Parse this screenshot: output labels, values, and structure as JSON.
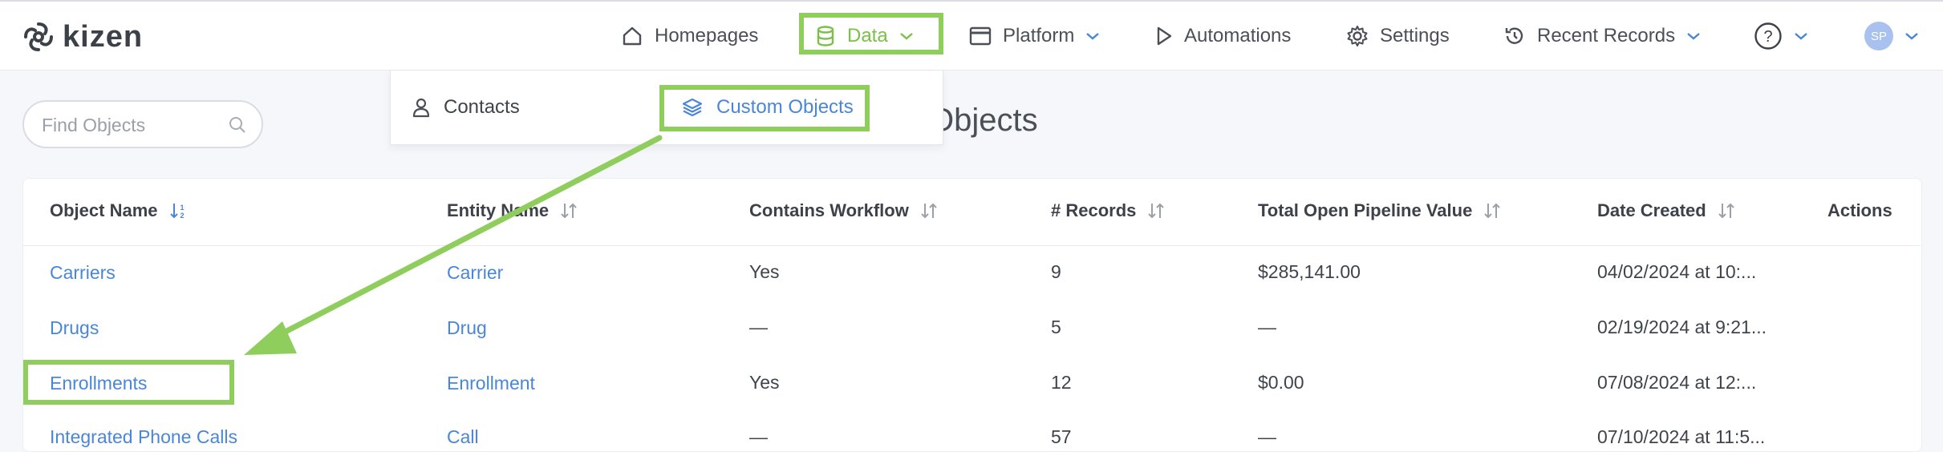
{
  "brand": {
    "name": "kizen"
  },
  "nav": {
    "homepages": "Homepages",
    "data": "Data",
    "platform": "Platform",
    "automations": "Automations",
    "settings": "Settings",
    "recent_records": "Recent Records",
    "help_icon": "question-circle-icon",
    "avatar_initials": "SP"
  },
  "dropdown": {
    "contacts": "Contacts",
    "custom_objects": "Custom Objects"
  },
  "search": {
    "placeholder": "Find Objects"
  },
  "page": {
    "title_visible_fragment": "Objects"
  },
  "table": {
    "columns": [
      "Object Name",
      "Entity Name",
      "Contains Workflow",
      "# Records",
      "Total Open Pipeline Value",
      "Date Created",
      "Actions"
    ],
    "rows": [
      [
        "Carriers",
        "Carrier",
        "Yes",
        "9",
        "$285,141.00",
        "04/02/2024 at 10:..."
      ],
      [
        "Drugs",
        "Drug",
        "—",
        "5",
        "—",
        "02/19/2024 at 9:21..."
      ],
      [
        "Enrollments",
        "Enrollment",
        "Yes",
        "12",
        "$0.00",
        "07/08/2024 at 12:..."
      ],
      [
        "Integrated Phone Calls",
        "Call",
        "—",
        "57",
        "—",
        "07/10/2024 at 11:5..."
      ]
    ]
  },
  "colors": {
    "highlight": "#8fcd5c",
    "link": "#4a86d8",
    "active_nav": "#7bc047",
    "arrow": "#8fcd5c",
    "avatar_bg": "#a9c1ee"
  }
}
